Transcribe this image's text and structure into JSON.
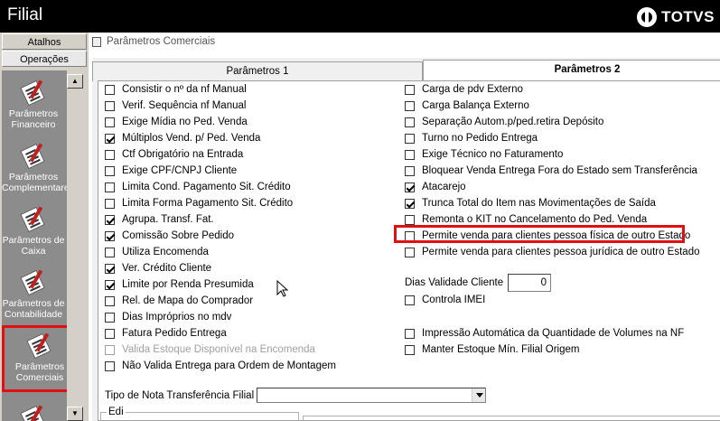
{
  "window": {
    "title": "Filial",
    "brand": "TOTVS"
  },
  "sidebar": {
    "tabs": [
      {
        "label": "Atalhos"
      },
      {
        "label": "Operações"
      }
    ],
    "items": [
      {
        "label": "Parâmetros Financeiro",
        "icon": "parameters-icon"
      },
      {
        "label": "Parâmetros Complementares",
        "icon": "parameters-icon"
      },
      {
        "label": "Parâmetros de Caixa",
        "icon": "parameters-icon"
      },
      {
        "label": "Parâmetros de Contabilidade",
        "icon": "parameters-icon"
      },
      {
        "label": "Parâmetros Comerciais",
        "icon": "parameters-icon",
        "selected": true
      }
    ]
  },
  "main": {
    "header_title": "Parâmetros Comerciais",
    "tabs": [
      {
        "label": "Parâmetros 1"
      },
      {
        "label": "Parâmetros 2",
        "active": true
      }
    ]
  },
  "left_options": [
    {
      "label": "Consistir o nº da nf Manual",
      "checked": false
    },
    {
      "label": "Verif. Sequência nf Manual",
      "checked": false
    },
    {
      "label": "Exige Mídia no Ped. Venda",
      "checked": false
    },
    {
      "label": "Múltiplos Vend. p/ Ped. Venda",
      "checked": true
    },
    {
      "label": "Ctf Obrigatório na Entrada",
      "checked": false
    },
    {
      "label": "Exige CPF/CNPJ Cliente",
      "checked": false
    },
    {
      "label": "Limita Cond. Pagamento Sit. Crédito",
      "checked": false
    },
    {
      "label": "Limita Forma Pagamento Sit. Crédito",
      "checked": false
    },
    {
      "label": "Agrupa. Transf. Fat.",
      "checked": true
    },
    {
      "label": "Comissão Sobre Pedido",
      "checked": true
    },
    {
      "label": "Utiliza Encomenda",
      "checked": false
    },
    {
      "label": "Ver. Crédito Cliente",
      "checked": true
    },
    {
      "label": "Limite por Renda Presumida",
      "checked": true
    },
    {
      "label": "Rel. de Mapa do Comprador",
      "checked": false
    },
    {
      "label": "Dias Impróprios no mdv",
      "checked": false
    },
    {
      "label": "Fatura Pedido Entrega",
      "checked": false
    },
    {
      "label": "Valida Estoque Disponível na Encomenda",
      "checked": false,
      "disabled": true
    },
    {
      "label": "Não Valida Entrega para Ordem de Montagem",
      "checked": false
    }
  ],
  "right_options": [
    {
      "label": "Carga de pdv Externo",
      "checked": false
    },
    {
      "label": "Carga Balança Externo",
      "checked": false
    },
    {
      "label": "Separação Autom.p/ped.retira Depósito",
      "checked": false
    },
    {
      "label": "Turno no Pedido Entrega",
      "checked": false
    },
    {
      "label": "Exige Técnico no Faturamento",
      "checked": false
    },
    {
      "label": "Bloquear Venda Entrega Fora do Estado sem Transferência",
      "checked": false
    },
    {
      "label": "Atacarejo",
      "checked": true
    },
    {
      "label": "Trunca Total do Item nas Movimentações de Saída",
      "checked": true
    },
    {
      "label": "Remonta o KIT no Cancelamento do Ped. Venda",
      "checked": false
    },
    {
      "label": "Permite venda para clientes pessoa física de outro Estado",
      "checked": false,
      "highlighted": true
    },
    {
      "label": "Permite venda para clientes pessoa jurídica de outro Estado",
      "checked": false
    }
  ],
  "dias_validade": {
    "label": "Dias Validade Cliente",
    "value": "0"
  },
  "extra_options": [
    {
      "label": "Controla IMEI",
      "checked": false
    },
    {
      "label": "Impressão Automática da Quantidade de Volumes na NF",
      "checked": false
    },
    {
      "label": "Manter Estoque Mín. Filial Origem",
      "checked": false
    }
  ],
  "tipo_nota": {
    "label": "Tipo de Nota Transferência Filial",
    "value": ""
  },
  "group_partial_label": "Edi",
  "colors": {
    "highlight": "#e01010",
    "sidebar_bg": "#8c8c8c",
    "titlebar_bg": "#000000"
  }
}
